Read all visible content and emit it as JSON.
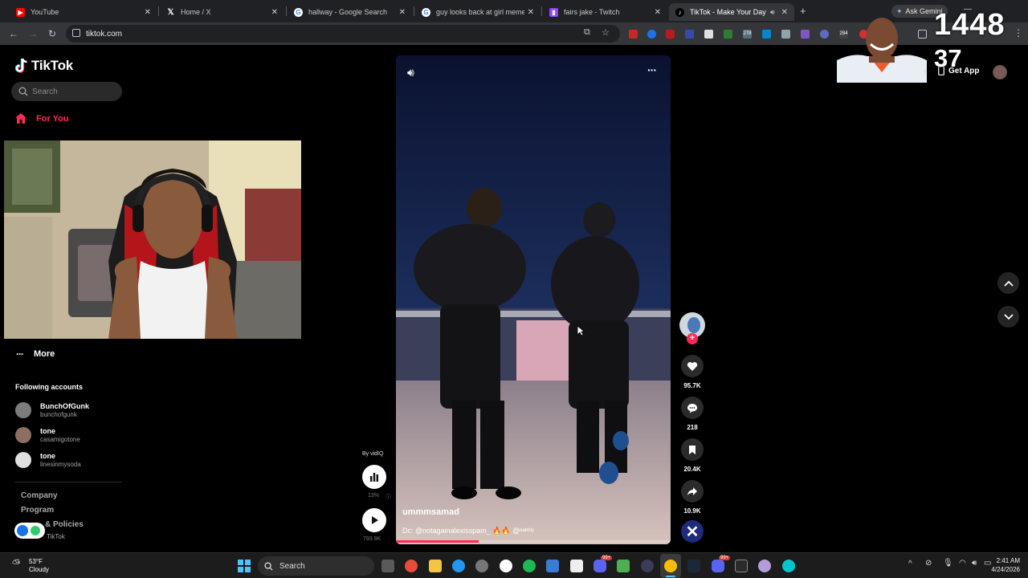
{
  "browser": {
    "tabs": [
      {
        "title": "YouTube",
        "icon": "youtube-icon"
      },
      {
        "title": "Home / X",
        "icon": "x-icon"
      },
      {
        "title": "hallway - Google Search",
        "icon": "google-icon"
      },
      {
        "title": "guy looks back at girl meme - G",
        "icon": "google-icon"
      },
      {
        "title": "fairs jake - Twitch",
        "icon": "twitch-icon"
      },
      {
        "title": "TikTok - Make Your Day",
        "icon": "tiktok-icon",
        "active": true
      }
    ],
    "url": "tiktok.com",
    "ask_gemini": "Ask Gemini",
    "ext_badges": [
      "278",
      "284"
    ]
  },
  "tiktok": {
    "logo": "TikTok",
    "search_placeholder": "Search",
    "nav_for_you": "For You",
    "nav_more": "More",
    "following_heading": "Following accounts",
    "following": [
      {
        "name": "BunchOfGunk",
        "handle": "bunchofgunk"
      },
      {
        "name": "tone",
        "handle": "casamigotone"
      },
      {
        "name": "tone",
        "handle": "linesinmysoda"
      }
    ],
    "footer": [
      "Company",
      "Program",
      "& Policies"
    ],
    "footer_brand": "TikTok",
    "get_app": "Get App",
    "get_app_partial": "s",
    "video": {
      "username": "ummmsamad",
      "caption": "Dc: @notagainalexisspam_ 🔥🔥 @ᵉᵃᵇᵇˡʸ",
      "progress": 0.3
    },
    "counts": {
      "likes": "95.7K",
      "comments": "218",
      "saves": "20.4K",
      "shares": "10.9K"
    },
    "by_label": "By vidIQ",
    "vidiq_percent": "13%",
    "vidiq_views": "793.9K"
  },
  "overlay": {
    "big_number_1": "1448",
    "big_number_2": "37"
  },
  "taskbar": {
    "weather_temp": "53°F",
    "weather_desc": "Cloudy",
    "search": "Search",
    "time": "2:41 AM",
    "date": "4/24/2026",
    "badge_1": "99+",
    "badge_2": "99+"
  },
  "colors": {
    "tiktok_red": "#fe2c55",
    "tiktok_cyan": "#25f4ee",
    "chrome_bg": "#202124",
    "toolbar_bg": "#35363a"
  }
}
